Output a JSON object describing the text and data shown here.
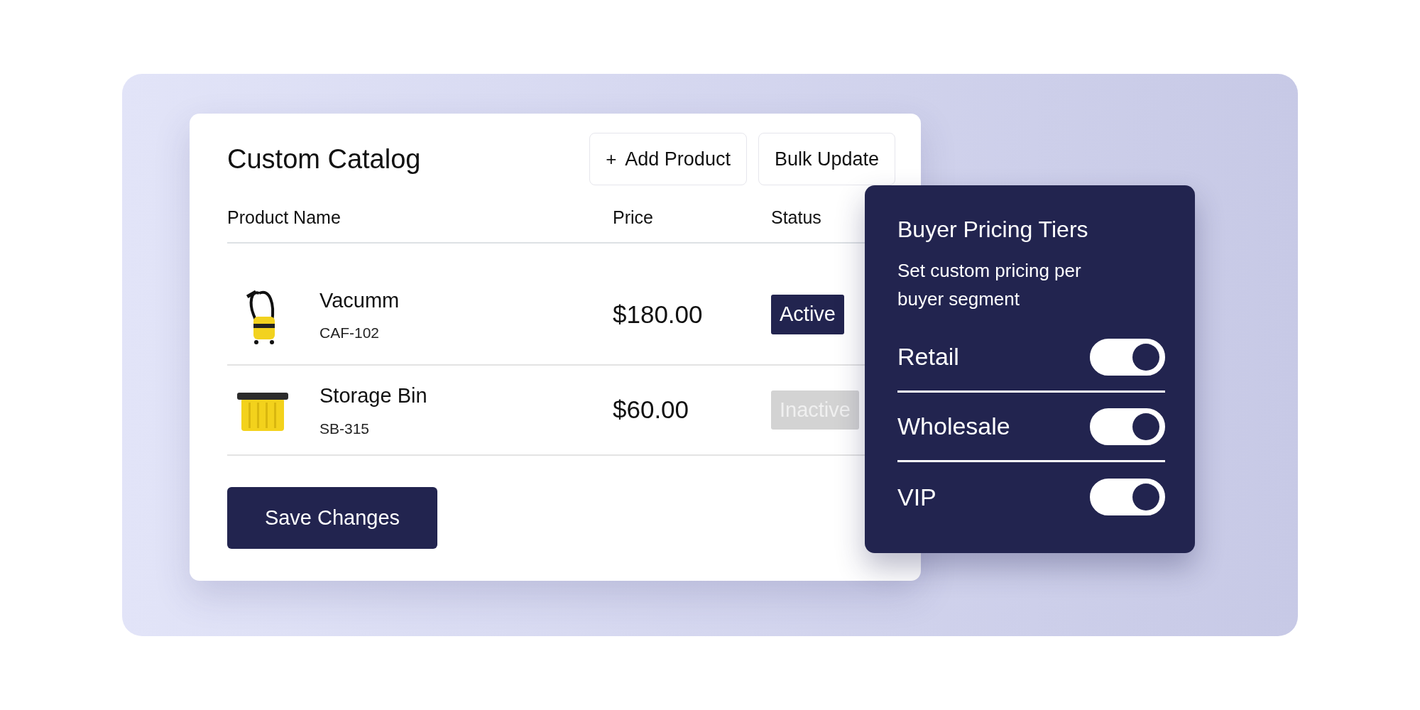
{
  "catalog": {
    "title": "Custom Catalog",
    "buttons": [
      {
        "kind": "add",
        "label": "Add Product",
        "icon": "+"
      },
      {
        "kind": "plain",
        "label": "Bulk Update"
      }
    ],
    "columns": [
      "Product Name",
      "Price",
      "Status"
    ],
    "rows": [
      {
        "name": "Vacumm",
        "sku": "CAF-102",
        "price": "$180.00",
        "status": "Active",
        "active": true
      },
      {
        "name": "Storage Bin",
        "sku": "SB-315",
        "price": "$60.00",
        "status": "Inactive",
        "active": false
      }
    ],
    "save_button": "Save Changes"
  },
  "tiers_panel": {
    "title": "Buyer Pricing Tiers",
    "description": "Set custom pricing per buyer segment",
    "tiers": [
      {
        "label": "Retail",
        "on": true
      },
      {
        "label": "Wholesale",
        "on": true
      },
      {
        "label": "VIP",
        "on": true
      }
    ]
  }
}
